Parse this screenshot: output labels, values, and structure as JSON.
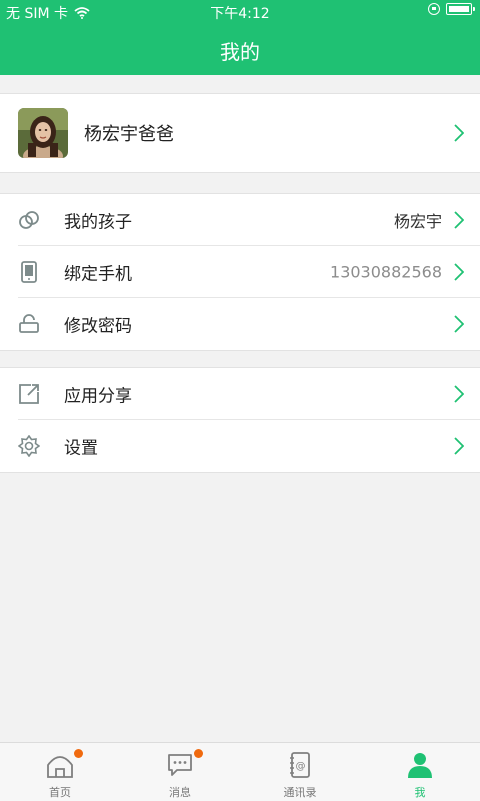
{
  "status_bar": {
    "carrier": "无 SIM 卡",
    "time": "下午4:12"
  },
  "header": {
    "title": "我的"
  },
  "profile": {
    "name": "杨宏宇爸爸"
  },
  "account_items": [
    {
      "label": "我的孩子",
      "value": "杨宏宇",
      "icon": "rings-icon"
    },
    {
      "label": "绑定手机",
      "value": "13030882568",
      "icon": "phone-icon"
    },
    {
      "label": "修改密码",
      "value": "",
      "icon": "lock-icon"
    }
  ],
  "other_items": [
    {
      "label": "应用分享",
      "icon": "share-icon"
    },
    {
      "label": "设置",
      "icon": "gear-icon"
    }
  ],
  "tabs": [
    {
      "label": "首页",
      "icon": "home-icon",
      "badge": true
    },
    {
      "label": "消息",
      "icon": "message-icon",
      "badge": true
    },
    {
      "label": "通讯录",
      "icon": "contacts-icon",
      "badge": false
    },
    {
      "label": "我",
      "icon": "person-icon",
      "badge": false,
      "active": true
    }
  ],
  "colors": {
    "accent": "#1fc173",
    "badge": "#f06a0f",
    "icon_gray": "#7d8b8b"
  }
}
